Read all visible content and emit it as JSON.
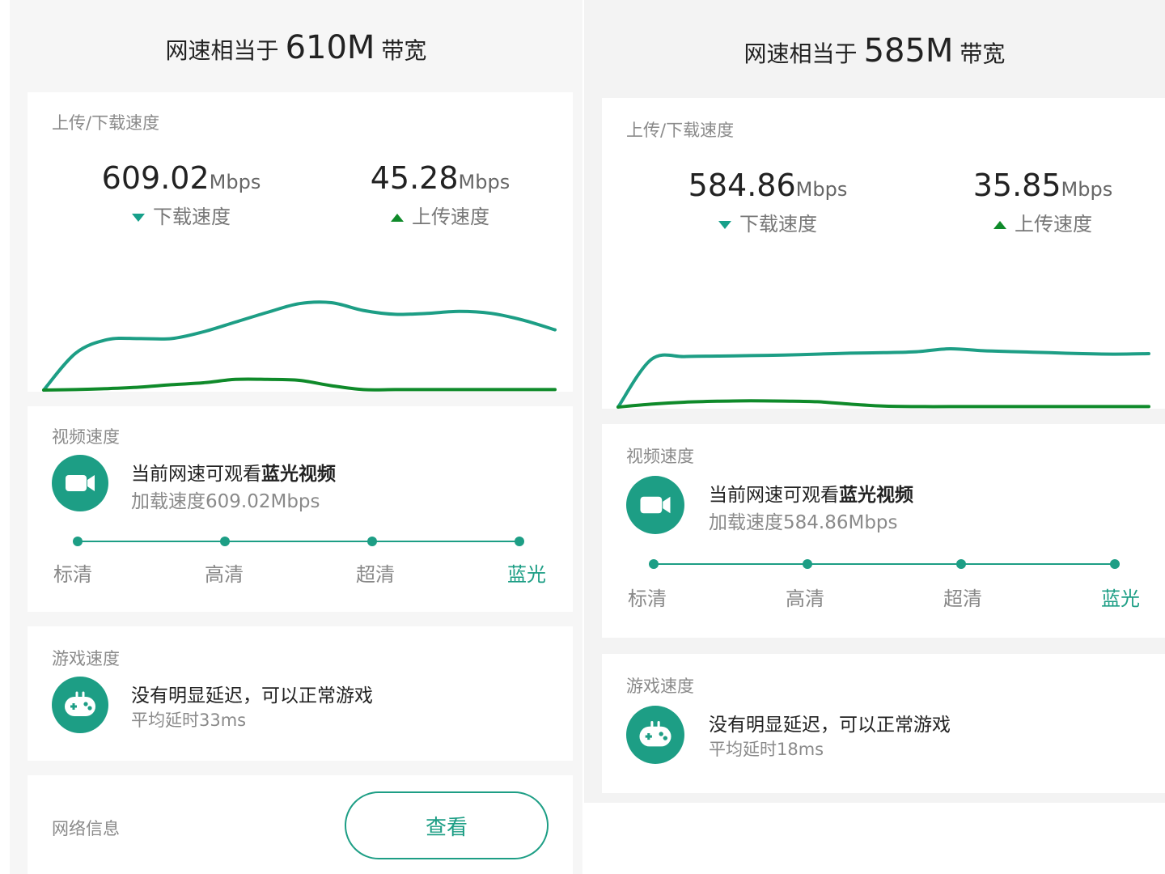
{
  "colors": {
    "accent": "#1d9e85",
    "download_line": "#1d9e85",
    "upload_line": "#0f8a2a"
  },
  "left": {
    "header": {
      "prefix": "网速相当于",
      "value": "610M",
      "suffix": "带宽"
    },
    "speed_card": {
      "title": "上传/下载速度",
      "download": {
        "value": "609.02",
        "unit": "Mbps",
        "label": "下载速度"
      },
      "upload": {
        "value": "45.28",
        "unit": "Mbps",
        "label": "上传速度"
      }
    },
    "chart_data": {
      "type": "line",
      "series": [
        {
          "values": [
            0,
            380,
            520,
            530,
            530,
            600,
            700,
            800,
            890,
            900,
            820,
            780,
            790,
            810,
            790,
            720,
            620
          ]
        },
        {
          "values": [
            0,
            5,
            15,
            30,
            55,
            75,
            110,
            110,
            100,
            45,
            5,
            5,
            5,
            5,
            5,
            5,
            5
          ]
        }
      ]
    },
    "video_card": {
      "title": "视频速度",
      "line_prefix": "当前网速可观看",
      "line_bold": "蓝光视频",
      "detail": "加载速度609.02Mbps",
      "levels": [
        "标清",
        "高清",
        "超清",
        "蓝光"
      ],
      "active_level": 3
    },
    "game_card": {
      "title": "游戏速度",
      "line": "没有明显延迟，可以正常游戏",
      "detail": "平均延时33ms"
    },
    "network_card": {
      "title": "网络信息",
      "button_label": "查看"
    }
  },
  "right": {
    "header": {
      "prefix": "网速相当于",
      "value": "585M",
      "suffix": "带宽"
    },
    "speed_card": {
      "title": "上传/下载速度",
      "download": {
        "value": "584.86",
        "unit": "Mbps",
        "label": "下载速度"
      },
      "upload": {
        "value": "35.85",
        "unit": "Mbps",
        "label": "上传速度"
      }
    },
    "chart_data": {
      "type": "line",
      "series": [
        {
          "values": [
            0,
            490,
            520,
            525,
            530,
            535,
            545,
            555,
            560,
            570,
            600,
            580,
            570,
            560,
            550,
            545,
            550
          ]
        },
        {
          "values": [
            0,
            30,
            50,
            60,
            65,
            62,
            55,
            30,
            10,
            5,
            5,
            5,
            5,
            5,
            5,
            5,
            5
          ]
        }
      ]
    },
    "video_card": {
      "title": "视频速度",
      "line_prefix": "当前网速可观看",
      "line_bold": "蓝光视频",
      "detail": "加载速度584.86Mbps",
      "levels": [
        "标清",
        "高清",
        "超清",
        "蓝光"
      ],
      "active_level": 3
    },
    "game_card": {
      "title": "游戏速度",
      "line": "没有明显延迟，可以正常游戏",
      "detail": "平均延时18ms"
    }
  }
}
